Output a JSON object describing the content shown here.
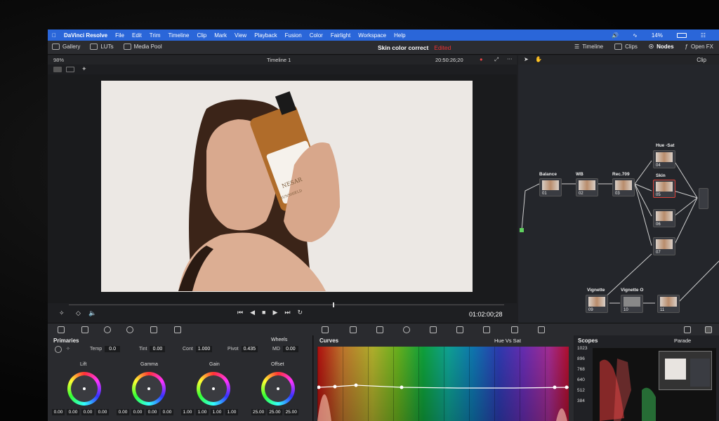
{
  "menubar": {
    "app": "DaVinci Resolve",
    "items": [
      "File",
      "Edit",
      "Trim",
      "Timeline",
      "Clip",
      "Mark",
      "View",
      "Playback",
      "Fusion",
      "Color",
      "Fairlight",
      "Workspace",
      "Help"
    ],
    "battery": "14%"
  },
  "toolbar": {
    "gallery": "Gallery",
    "luts": "LUTs",
    "media_pool": "Media Pool",
    "project": "Skin color correct",
    "status": "Edited",
    "timeline": "Timeline",
    "clips": "Clips",
    "nodes": "Nodes",
    "openfx": "Open FX"
  },
  "viewer": {
    "zoom": "98%",
    "timeline_name": "Timeline 1",
    "timecode": "20:50:26;20",
    "end_timecode": "01:02:00;28",
    "product_brand": "NESAR",
    "product_name": "SUNSHIELD"
  },
  "nodes_panel": {
    "mode": "Clip",
    "nodes": [
      {
        "label": "Balance",
        "num": "01"
      },
      {
        "label": "WB",
        "num": "02"
      },
      {
        "label": "Rec.709",
        "num": "03"
      },
      {
        "label": "Hue -Sat",
        "num": "04"
      },
      {
        "label": "Skin",
        "num": "05"
      },
      {
        "label": "",
        "num": "06"
      },
      {
        "label": "",
        "num": "07"
      },
      {
        "label": "Vignette",
        "num": "09"
      },
      {
        "label": "Vignette O",
        "num": "10"
      },
      {
        "label": "",
        "num": "11"
      }
    ]
  },
  "primaries": {
    "title": "Primaries",
    "mode": "Wheels",
    "temp_label": "Temp",
    "temp": "0.0",
    "tint_label": "Tint",
    "tint": "0.00",
    "cont_label": "Cont",
    "cont": "1.000",
    "pivot_label": "Pivot",
    "pivot": "0.435",
    "md_label": "MD",
    "md": "0.00",
    "wheels": [
      {
        "label": "Lift",
        "values": [
          "0.00",
          "0.00",
          "0.00",
          "0.00"
        ]
      },
      {
        "label": "Gamma",
        "values": [
          "0.00",
          "0.00",
          "0.00",
          "0.00"
        ]
      },
      {
        "label": "Gain",
        "values": [
          "1.00",
          "1.00",
          "1.00",
          "1.00"
        ]
      },
      {
        "label": "Offset",
        "values": [
          "25.00",
          "25.00",
          "25.00"
        ]
      }
    ]
  },
  "curves": {
    "title": "Curves",
    "mode": "Hue Vs Sat"
  },
  "scopes": {
    "title": "Scopes",
    "mode": "Parade",
    "axis": [
      "1023",
      "896",
      "768",
      "640",
      "512",
      "384"
    ]
  }
}
